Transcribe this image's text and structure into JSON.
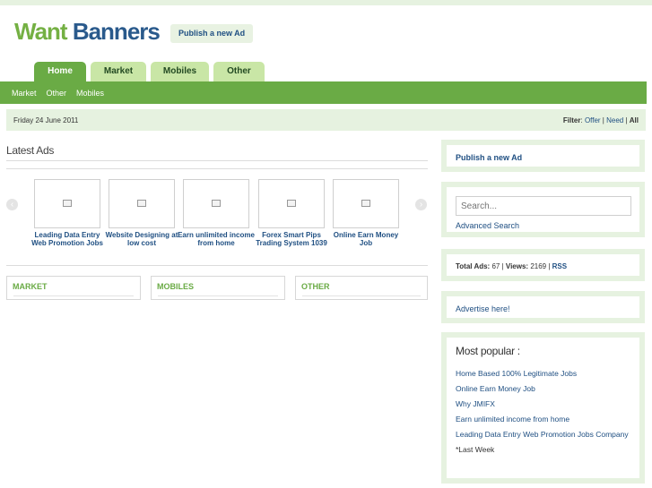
{
  "header": {
    "logo_part1": "Want",
    "logo_part2": "Banners",
    "publish_button": "Publish a new Ad"
  },
  "tabs": [
    {
      "label": "Home",
      "active": true
    },
    {
      "label": "Market",
      "active": false
    },
    {
      "label": "Mobiles",
      "active": false
    },
    {
      "label": "Other",
      "active": false
    }
  ],
  "subnav": [
    "Market",
    "Other",
    "Mobiles"
  ],
  "datebar": {
    "date": "Friday 24 June 2011",
    "filter_label": "Filter",
    "filter_offer": "Offer",
    "filter_need": "Need",
    "filter_all": "All"
  },
  "latest": {
    "title": "Latest Ads",
    "ads": [
      {
        "caption": "Leading Data Entry Web Promotion Jobs"
      },
      {
        "caption": "Website Designing at low cost"
      },
      {
        "caption": "Earn unlimited income from home"
      },
      {
        "caption": "Forex Smart Pips Trading System 1039"
      },
      {
        "caption": "Online Earn Money Job"
      }
    ]
  },
  "categories": [
    "MARKET",
    "MOBILES",
    "OTHER"
  ],
  "sidebar": {
    "publish": "Publish a new Ad",
    "search_placeholder": "Search...",
    "advanced_search": "Advanced Search",
    "stats": {
      "total_ads_label": "Total Ads:",
      "total_ads": "67",
      "views_label": "Views:",
      "views": "2169",
      "rss": "RSS"
    },
    "advertise": "Advertise here!",
    "most_popular_title": "Most popular :",
    "most_popular": [
      "Home Based 100% Legitimate Jobs",
      "Online Earn Money Job",
      "Why JMIFX",
      "Earn unlimited income from home",
      "Leading Data Entry Web Promotion Jobs Company"
    ],
    "most_popular_footer": "*Last Week"
  },
  "colors": {
    "accent_green": "#6aab45",
    "light_green": "#e6f2e0",
    "link_blue": "#1f4f82"
  }
}
